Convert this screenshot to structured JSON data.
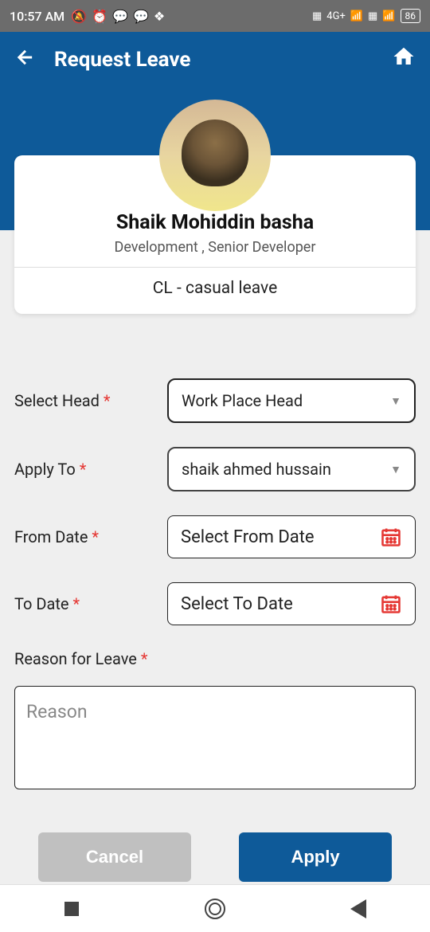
{
  "status": {
    "time": "10:57 AM",
    "battery": "86",
    "network": "4G+"
  },
  "header": {
    "title": "Request Leave"
  },
  "profile": {
    "name": "Shaik Mohiddin basha",
    "role": "Development  , Senior Developer",
    "leave_type": "CL - casual leave"
  },
  "form": {
    "select_head": {
      "label": "Select Head",
      "value": "Work Place Head"
    },
    "apply_to": {
      "label": "Apply To",
      "value": "shaik ahmed hussain"
    },
    "from_date": {
      "label": "From Date",
      "placeholder": "Select From Date"
    },
    "to_date": {
      "label": "To Date",
      "placeholder": "Select To Date"
    },
    "reason": {
      "label": "Reason for Leave",
      "placeholder": "Reason"
    }
  },
  "buttons": {
    "cancel": "Cancel",
    "apply": "Apply"
  }
}
